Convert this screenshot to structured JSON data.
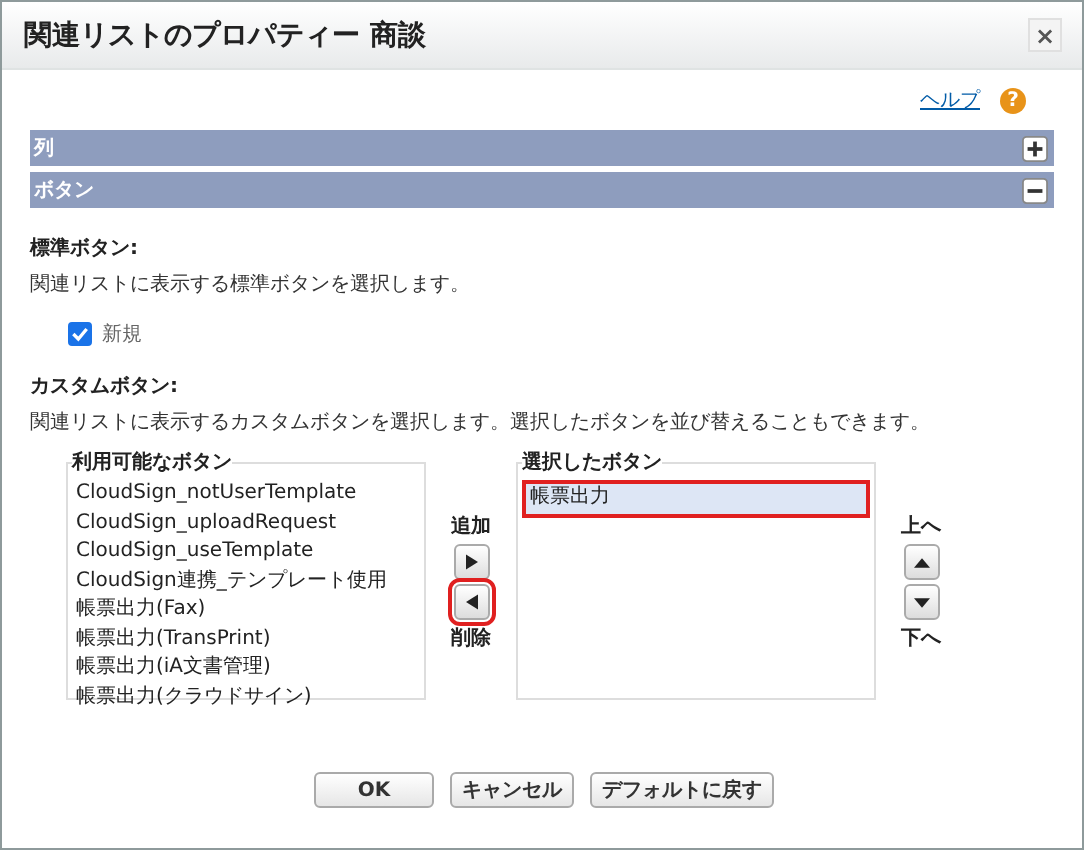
{
  "window": {
    "title": "関連リストのプロパティー 商談",
    "close": "×"
  },
  "help": {
    "label": "ヘルプ",
    "icon": "?"
  },
  "sections": [
    {
      "label": "列",
      "expanded": false
    },
    {
      "label": "ボタン",
      "expanded": true
    }
  ],
  "standard_buttons": {
    "heading": "標準ボタン:",
    "description": "関連リストに表示する標準ボタンを選択します。",
    "options": [
      {
        "label": "新規",
        "checked": true
      }
    ]
  },
  "custom_buttons": {
    "heading": "カスタムボタン:",
    "description": "関連リストに表示するカスタムボタンを選択します。選択したボタンを並び替えることもできます。",
    "available": {
      "label": "利用可能なボタン",
      "items": [
        "CloudSign_notUserTemplate",
        "CloudSign_uploadRequest",
        "CloudSign_useTemplate",
        "CloudSign連携_テンプレート使用",
        "帳票出力(Fax)",
        "帳票出力(TransPrint)",
        "帳票出力(iA文書管理)",
        "帳票出力(クラウドサイン)"
      ]
    },
    "add_label": "追加",
    "remove_label": "削除",
    "remove_highlighted": true,
    "chosen": {
      "label": "選択したボタン",
      "items": [
        {
          "label": "帳票出力",
          "selected": true,
          "highlighted": true
        }
      ]
    },
    "up_label": "上へ",
    "down_label": "下へ"
  },
  "buttons": [
    "OK",
    "キャンセル",
    "デフォルトに戻す"
  ]
}
